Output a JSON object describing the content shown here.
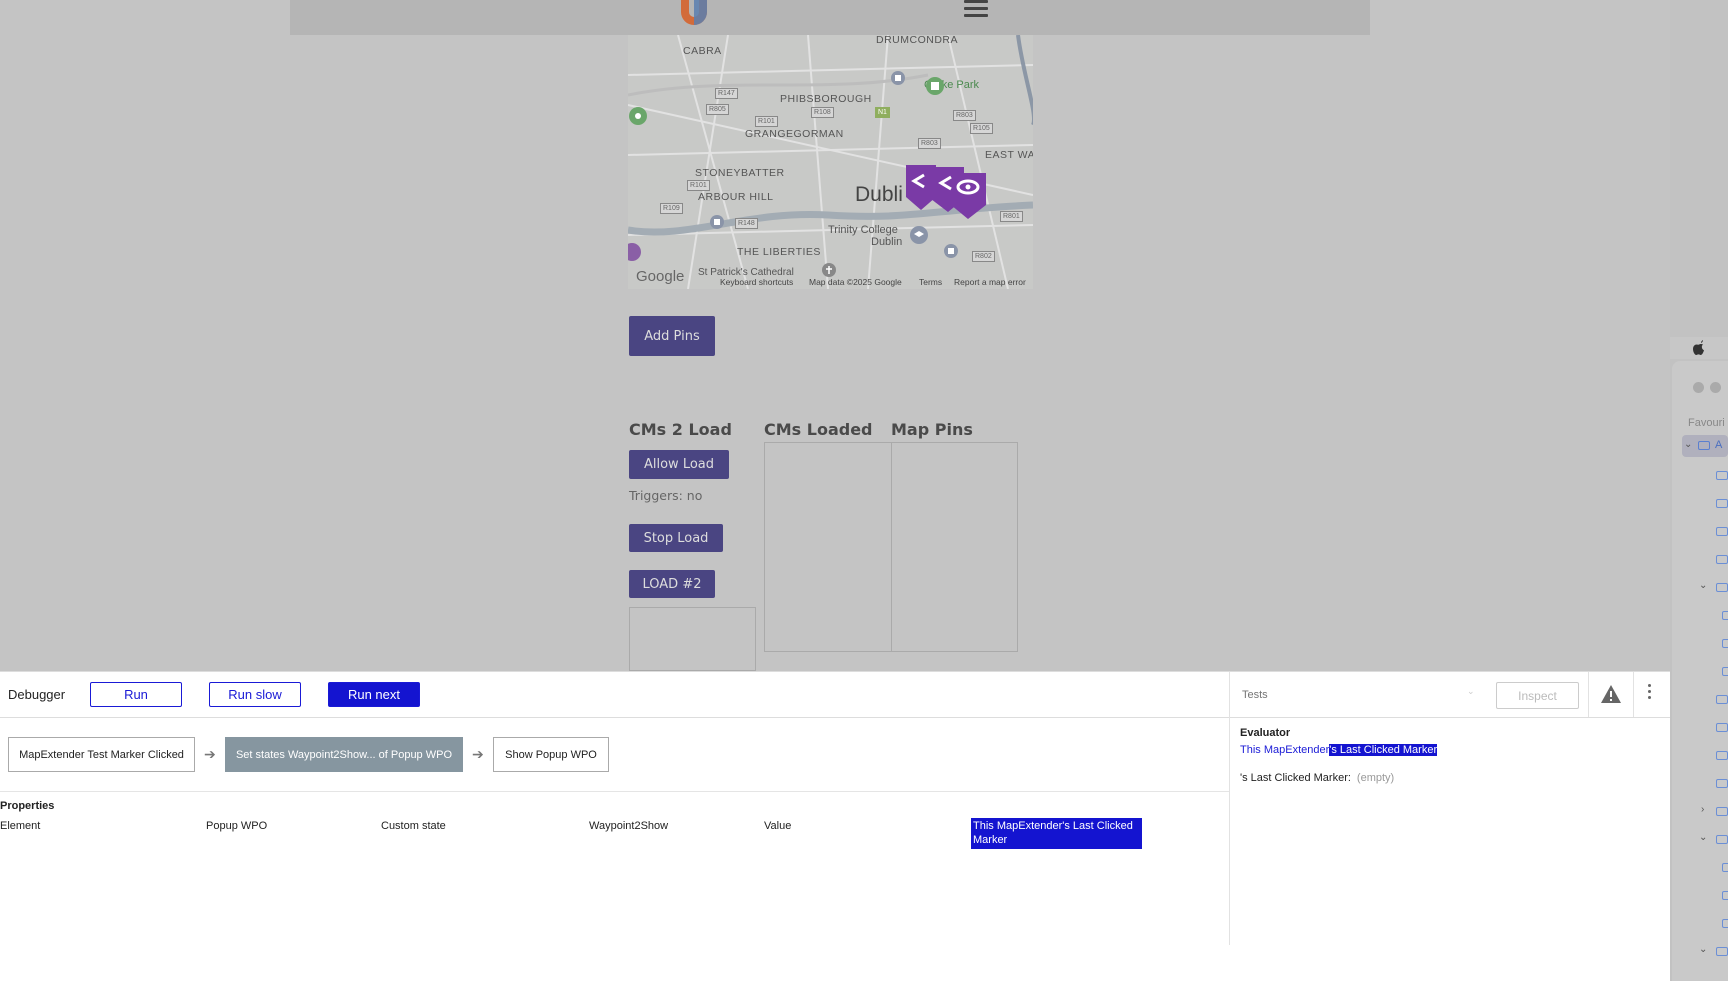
{
  "map": {
    "neighborhoods": [
      "CABRA",
      "DRUMCONDRA",
      "PHIBSBOROUGH",
      "GRANGEGORMAN",
      "STONEYBATTER",
      "ARBOUR HILL",
      "EAST WA",
      "THE LIBERTIES"
    ],
    "city": "Dubli",
    "places": [
      "Croke Park",
      "Trinity College",
      "Dublin",
      "St Patrick's Cathedral"
    ],
    "roads": [
      "R147",
      "R805",
      "R101",
      "R108",
      "N1",
      "R803",
      "R105",
      "R803",
      "R101",
      "R109",
      "R148",
      "R801",
      "R802"
    ],
    "brand": "Google",
    "footer": [
      "Keyboard shortcuts",
      "Map data ©2025 Google",
      "Terms",
      "Report a map error"
    ]
  },
  "page": {
    "add_pins": "Add Pins",
    "cms2load": "CMs 2 Load",
    "cms_loaded": "CMs Loaded",
    "map_pins": "Map Pins",
    "allow_load": "Allow Load",
    "triggers": "Triggers:  no",
    "stop_load": "Stop Load",
    "load2": "LOAD #2"
  },
  "debugger": {
    "title": "Debugger",
    "run": "Run",
    "run_slow": "Run slow",
    "run_next": "Run next",
    "steps": [
      "MapExtender Test Marker Clicked",
      "Set states Waypoint2Show... of Popup WPO",
      "Show Popup WPO"
    ],
    "properties_title": "Properties",
    "properties": {
      "element_label": "Element",
      "element_value": "Popup WPO",
      "custom_state_label": "Custom state",
      "custom_state_value": "Waypoint2Show",
      "value_label": "Value",
      "value": "This MapExtender's Last Clicked Marker"
    },
    "search_placeholder": "Tests",
    "inspect": "Inspect",
    "evaluator_title": "Evaluator",
    "eval_expr_plain": "This MapExtender",
    "eval_expr_selected": "'s Last Clicked Marker",
    "eval_line_label": "'s Last Clicked Marker:",
    "eval_line_value": "(empty)"
  },
  "finder": {
    "favourites": "Favouri",
    "selected_item_letter": "A"
  },
  "colors": {
    "accent": "#1414d0",
    "button_purple": "#4a4582",
    "pin_purple": "#7a3aa6"
  }
}
